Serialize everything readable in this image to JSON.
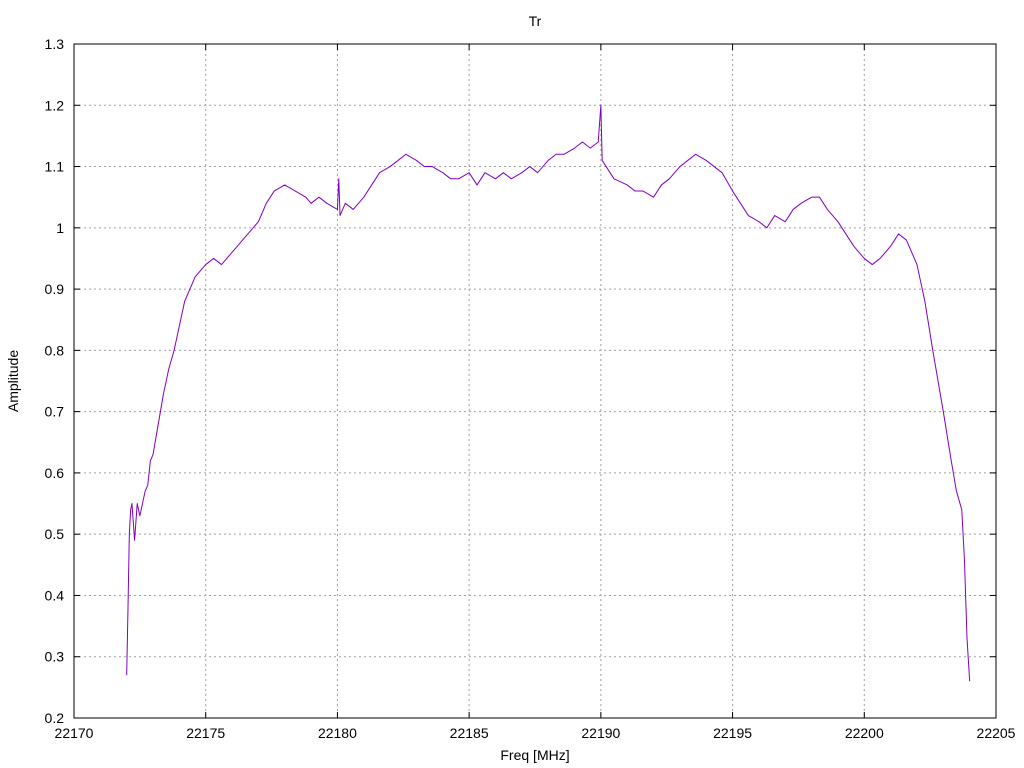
{
  "chart_data": {
    "type": "line",
    "title": "Tr",
    "xlabel": "Freq [MHz]",
    "ylabel": "Amplitude",
    "xlim": [
      22170,
      22205
    ],
    "ylim": [
      0.2,
      1.3
    ],
    "xticks": [
      22170,
      22175,
      22180,
      22185,
      22190,
      22195,
      22200,
      22205
    ],
    "yticks": [
      0.2,
      0.3,
      0.4,
      0.5,
      0.6,
      0.7,
      0.8,
      0.9,
      1,
      1.1,
      1.2,
      1.3
    ],
    "ytick_labels": [
      "0.2",
      "0.3",
      "0.4",
      "0.5",
      "0.6",
      "0.7",
      "0.8",
      "0.9",
      "1",
      "1.1",
      "1.2",
      "1.3"
    ],
    "grid": true,
    "line_color": "#8000c0",
    "series": [
      {
        "x": [
          22172.0,
          22172.05,
          22172.1,
          22172.15,
          22172.2,
          22172.3,
          22172.4,
          22172.5,
          22172.6,
          22172.7,
          22172.8,
          22172.9,
          22173.0,
          22173.2,
          22173.4,
          22173.6,
          22173.8,
          22174.0,
          22174.2,
          22174.4,
          22174.6,
          22174.8,
          22175.0,
          22175.3,
          22175.6,
          22176.0,
          22176.4,
          22176.8,
          22177.0,
          22177.3,
          22177.6,
          22178.0,
          22178.4,
          22178.8,
          22179.0,
          22179.3,
          22179.6,
          22180.0,
          22180.05,
          22180.1,
          22180.3,
          22180.6,
          22181.0,
          22181.3,
          22181.6,
          22182.0,
          22182.3,
          22182.6,
          22183.0,
          22183.3,
          22183.6,
          22184.0,
          22184.3,
          22184.6,
          22185.0,
          22185.3,
          22185.6,
          22186.0,
          22186.3,
          22186.6,
          22187.0,
          22187.3,
          22187.6,
          22188.0,
          22188.3,
          22188.6,
          22189.0,
          22189.3,
          22189.6,
          22189.9,
          22190.0,
          22190.05,
          22190.2,
          22190.5,
          22191.0,
          22191.3,
          22191.6,
          22192.0,
          22192.3,
          22192.6,
          22193.0,
          22193.3,
          22193.6,
          22194.0,
          22194.3,
          22194.6,
          22195.0,
          22195.3,
          22195.6,
          22196.0,
          22196.3,
          22196.6,
          22197.0,
          22197.3,
          22197.6,
          22198.0,
          22198.3,
          22198.6,
          22199.0,
          22199.3,
          22199.6,
          22200.0,
          22200.3,
          22200.6,
          22201.0,
          22201.3,
          22201.6,
          22202.0,
          22202.3,
          22202.6,
          22203.0,
          22203.3,
          22203.5,
          22203.7,
          22203.8,
          22203.9,
          22204.0
        ],
        "y": [
          0.27,
          0.38,
          0.5,
          0.54,
          0.55,
          0.49,
          0.55,
          0.53,
          0.55,
          0.57,
          0.58,
          0.62,
          0.63,
          0.68,
          0.73,
          0.77,
          0.8,
          0.84,
          0.88,
          0.9,
          0.92,
          0.93,
          0.94,
          0.95,
          0.94,
          0.96,
          0.98,
          1.0,
          1.01,
          1.04,
          1.06,
          1.07,
          1.06,
          1.05,
          1.04,
          1.05,
          1.04,
          1.03,
          1.08,
          1.02,
          1.04,
          1.03,
          1.05,
          1.07,
          1.09,
          1.1,
          1.11,
          1.12,
          1.11,
          1.1,
          1.1,
          1.09,
          1.08,
          1.08,
          1.09,
          1.07,
          1.09,
          1.08,
          1.09,
          1.08,
          1.09,
          1.1,
          1.09,
          1.11,
          1.12,
          1.12,
          1.13,
          1.14,
          1.13,
          1.14,
          1.2,
          1.11,
          1.1,
          1.08,
          1.07,
          1.06,
          1.06,
          1.05,
          1.07,
          1.08,
          1.1,
          1.11,
          1.12,
          1.11,
          1.1,
          1.09,
          1.06,
          1.04,
          1.02,
          1.01,
          1.0,
          1.02,
          1.01,
          1.03,
          1.04,
          1.05,
          1.05,
          1.03,
          1.01,
          0.99,
          0.97,
          0.95,
          0.94,
          0.95,
          0.97,
          0.99,
          0.98,
          0.94,
          0.88,
          0.8,
          0.7,
          0.62,
          0.57,
          0.54,
          0.46,
          0.33,
          0.26
        ]
      }
    ]
  }
}
